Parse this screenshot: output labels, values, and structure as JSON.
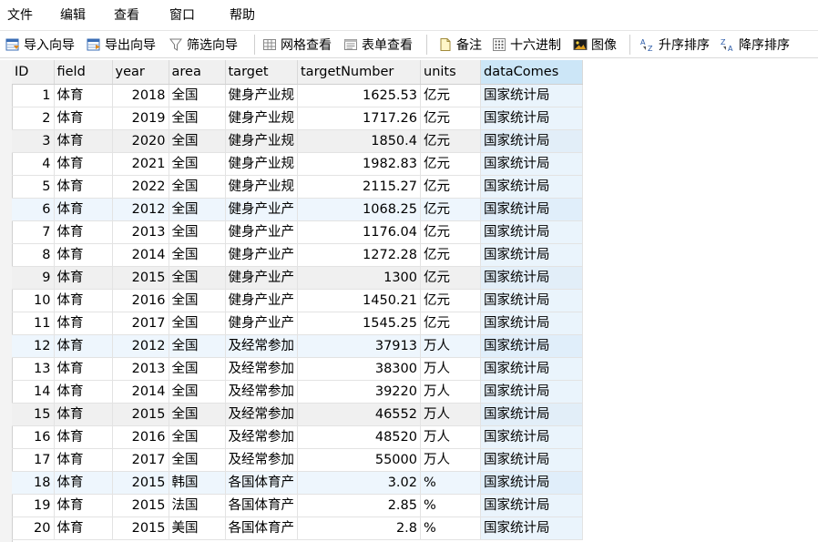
{
  "menu": [
    "文件",
    "编辑",
    "查看",
    "窗口",
    "帮助"
  ],
  "toolbar": {
    "import_wizard": "导入向导",
    "export_wizard": "导出向导",
    "filter_wizard": "筛选向导",
    "grid_view": "网格查看",
    "form_view": "表单查看",
    "memo": "备注",
    "hex": "十六进制",
    "image": "图像",
    "sort_asc": "升序排序",
    "sort_desc": "降序排序"
  },
  "table": {
    "columns": [
      "ID",
      "field",
      "year",
      "area",
      "target",
      "targetNumber",
      "units",
      "dataComes"
    ],
    "rows": [
      [
        "1",
        "体育",
        "2018",
        "全国",
        "健身产业规",
        "1625.53",
        "亿元",
        "国家统计局"
      ],
      [
        "2",
        "体育",
        "2019",
        "全国",
        "健身产业规",
        "1717.26",
        "亿元",
        "国家统计局"
      ],
      [
        "3",
        "体育",
        "2020",
        "全国",
        "健身产业规",
        "1850.4",
        "亿元",
        "国家统计局"
      ],
      [
        "4",
        "体育",
        "2021",
        "全国",
        "健身产业规",
        "1982.83",
        "亿元",
        "国家统计局"
      ],
      [
        "5",
        "体育",
        "2022",
        "全国",
        "健身产业规",
        "2115.27",
        "亿元",
        "国家统计局"
      ],
      [
        "6",
        "体育",
        "2012",
        "全国",
        "健身产业产",
        "1068.25",
        "亿元",
        "国家统计局"
      ],
      [
        "7",
        "体育",
        "2013",
        "全国",
        "健身产业产",
        "1176.04",
        "亿元",
        "国家统计局"
      ],
      [
        "8",
        "体育",
        "2014",
        "全国",
        "健身产业产",
        "1272.28",
        "亿元",
        "国家统计局"
      ],
      [
        "9",
        "体育",
        "2015",
        "全国",
        "健身产业产",
        "1300",
        "亿元",
        "国家统计局"
      ],
      [
        "10",
        "体育",
        "2016",
        "全国",
        "健身产业产",
        "1450.21",
        "亿元",
        "国家统计局"
      ],
      [
        "11",
        "体育",
        "2017",
        "全国",
        "健身产业产",
        "1545.25",
        "亿元",
        "国家统计局"
      ],
      [
        "12",
        "体育",
        "2012",
        "全国",
        "及经常参加",
        "37913",
        "万人",
        "国家统计局"
      ],
      [
        "13",
        "体育",
        "2013",
        "全国",
        "及经常参加",
        "38300",
        "万人",
        "国家统计局"
      ],
      [
        "14",
        "体育",
        "2014",
        "全国",
        "及经常参加",
        "39220",
        "万人",
        "国家统计局"
      ],
      [
        "15",
        "体育",
        "2015",
        "全国",
        "及经常参加",
        "46552",
        "万人",
        "国家统计局"
      ],
      [
        "16",
        "体育",
        "2016",
        "全国",
        "及经常参加",
        "48520",
        "万人",
        "国家统计局"
      ],
      [
        "17",
        "体育",
        "2017",
        "全国",
        "及经常参加",
        "55000",
        "万人",
        "国家统计局"
      ],
      [
        "18",
        "体育",
        "2015",
        "韩国",
        "各国体育产",
        "3.02",
        "%",
        "国家统计局"
      ],
      [
        "19",
        "体育",
        "2015",
        "法国",
        "各国体育产",
        "2.85",
        "%",
        "国家统计局"
      ],
      [
        "20",
        "体育",
        "2015",
        "美国",
        "各国体育产",
        "2.8",
        "%",
        "国家统计局"
      ]
    ],
    "selected_column": "dataComes"
  },
  "colors": {
    "selected_header": "#cce6f7",
    "alt_row": "#f0f0f0",
    "highlight_row": "#eef6fd"
  }
}
